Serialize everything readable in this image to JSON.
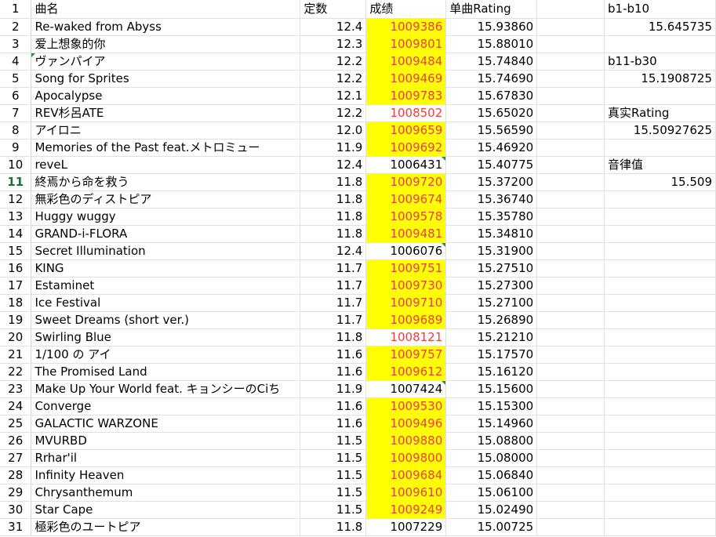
{
  "headers": {
    "row_num": "1",
    "title": "曲名",
    "const": "定数",
    "score": "成绩",
    "rating": "单曲Rating",
    "side_label": "b1-b10"
  },
  "side": [
    {
      "row": 2,
      "value": "15.645735",
      "type": "value"
    },
    {
      "row": 4,
      "value": "b11-b30",
      "type": "label"
    },
    {
      "row": 5,
      "value": "15.1908725",
      "type": "value"
    },
    {
      "row": 7,
      "value": "真实Rating",
      "type": "label"
    },
    {
      "row": 8,
      "value": "15.50927625",
      "type": "value"
    },
    {
      "row": 10,
      "value": "音律值",
      "type": "label"
    },
    {
      "row": 11,
      "value": "15.509",
      "type": "value"
    }
  ],
  "rows": [
    {
      "n": "2",
      "title": "Re-waked from Abyss",
      "const": "12.4",
      "score": "1009386",
      "rating": "15.93860",
      "hl": true
    },
    {
      "n": "3",
      "title": "爱上想象的你",
      "const": "12.3",
      "score": "1009801",
      "rating": "15.88010",
      "hl": true
    },
    {
      "n": "4",
      "title": "ヴァンパイア",
      "const": "12.2",
      "score": "1009484",
      "rating": "15.74840",
      "hl": true,
      "mark_title": true
    },
    {
      "n": "5",
      "title": "Song for Sprites",
      "const": "12.2",
      "score": "1009469",
      "rating": "15.74690",
      "hl": true
    },
    {
      "n": "6",
      "title": "Apocalypse",
      "const": "12.1",
      "score": "1009783",
      "rating": "15.67830",
      "hl": true
    },
    {
      "n": "7",
      "title": "REV杉呂ATE",
      "const": "12.2",
      "score": "1008502",
      "rating": "15.65020",
      "red": true
    },
    {
      "n": "8",
      "title": "アイロニ",
      "const": "12.0",
      "score": "1009659",
      "rating": "15.56590",
      "hl": true
    },
    {
      "n": "9",
      "title": "Memories of the Past feat.メトロミュー",
      "const": "11.9",
      "score": "1009692",
      "rating": "15.46920",
      "hl": true
    },
    {
      "n": "10",
      "title": "reveL",
      "const": "12.4",
      "score": "1006431",
      "rating": "15.40775",
      "mark_score": true
    },
    {
      "n": "11",
      "title": "終焉から命を救う",
      "const": "11.8",
      "score": "1009720",
      "rating": "15.37200",
      "hl": true,
      "active": true
    },
    {
      "n": "12",
      "title": "無彩色のディストピア",
      "const": "11.8",
      "score": "1009674",
      "rating": "15.36740",
      "hl": true
    },
    {
      "n": "13",
      "title": "Huggy wuggy",
      "const": "11.8",
      "score": "1009578",
      "rating": "15.35780",
      "hl": true
    },
    {
      "n": "14",
      "title": "GRAND-i-FLORA",
      "const": "11.8",
      "score": "1009481",
      "rating": "15.34810",
      "hl": true
    },
    {
      "n": "15",
      "title": "Secret Illumination",
      "const": "12.4",
      "score": "1006076",
      "rating": "15.31900",
      "mark_score": true
    },
    {
      "n": "16",
      "title": "KING",
      "const": "11.7",
      "score": "1009751",
      "rating": "15.27510",
      "hl": true
    },
    {
      "n": "17",
      "title": "Estaminet",
      "const": "11.7",
      "score": "1009730",
      "rating": "15.27300",
      "hl": true
    },
    {
      "n": "18",
      "title": "Ice Festival",
      "const": "11.7",
      "score": "1009710",
      "rating": "15.27100",
      "hl": true
    },
    {
      "n": "19",
      "title": "Sweet Dreams (short ver.)",
      "const": "11.7",
      "score": "1009689",
      "rating": "15.26890",
      "hl": true
    },
    {
      "n": "20",
      "title": "Swirling Blue",
      "const": "11.8",
      "score": "1008121",
      "rating": "15.21210",
      "red": true
    },
    {
      "n": "21",
      "title": "1/100 の アイ",
      "const": "11.6",
      "score": "1009757",
      "rating": "15.17570",
      "hl": true
    },
    {
      "n": "22",
      "title": "The Promised Land",
      "const": "11.6",
      "score": "1009612",
      "rating": "15.16120",
      "hl": true
    },
    {
      "n": "23",
      "title": "Make Up Your World feat. キョンシーのCiち",
      "const": "11.9",
      "score": "1007424",
      "rating": "15.15600",
      "mark_score": true
    },
    {
      "n": "24",
      "title": "Converge",
      "const": "11.6",
      "score": "1009530",
      "rating": "15.15300",
      "hl": true
    },
    {
      "n": "25",
      "title": "GALACTIC WARZONE",
      "const": "11.6",
      "score": "1009496",
      "rating": "15.14960",
      "hl": true
    },
    {
      "n": "26",
      "title": "MVURBD",
      "const": "11.5",
      "score": "1009880",
      "rating": "15.08800",
      "hl": true
    },
    {
      "n": "27",
      "title": "Rrhar'il",
      "const": "11.5",
      "score": "1009800",
      "rating": "15.08000",
      "hl": true
    },
    {
      "n": "28",
      "title": "Infinity Heaven",
      "const": "11.5",
      "score": "1009684",
      "rating": "15.06840",
      "hl": true
    },
    {
      "n": "29",
      "title": "Chrysanthemum",
      "const": "11.5",
      "score": "1009610",
      "rating": "15.06100",
      "hl": true
    },
    {
      "n": "30",
      "title": "Star Cape",
      "const": "11.5",
      "score": "1009249",
      "rating": "15.02490",
      "hl": true
    },
    {
      "n": "31",
      "title": "極彩色のユートピア",
      "const": "11.8",
      "score": "1007229",
      "rating": "15.00725"
    }
  ]
}
